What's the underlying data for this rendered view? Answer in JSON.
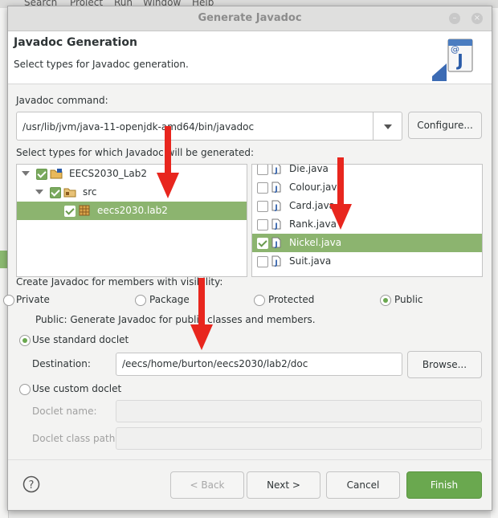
{
  "background": {
    "menu": [
      "Search",
      "Project",
      "Run",
      "Window",
      "Help"
    ]
  },
  "dialog": {
    "title": "Generate Javadoc",
    "header": {
      "title": "Javadoc Generation",
      "description": "Select types for Javadoc generation."
    },
    "command": {
      "label": "Javadoc command:",
      "value": "/usr/lib/jvm/java-11-openjdk-amd64/bin/javadoc",
      "configure_label": "Configure..."
    },
    "types_label": "Select types for which Javadoc will be generated:",
    "tree": [
      {
        "label": "EECS2030_Lab2",
        "checked": true,
        "icon": "project-icon"
      },
      {
        "label": "src",
        "checked": true,
        "icon": "source-folder-icon"
      },
      {
        "label": "eecs2030.lab2",
        "checked": true,
        "icon": "package-icon",
        "selected": true
      }
    ],
    "files": [
      {
        "label": "Die.java",
        "checked": false
      },
      {
        "label": "Colour.java",
        "checked": false
      },
      {
        "label": "Card.java",
        "checked": false
      },
      {
        "label": "Rank.java",
        "checked": false
      },
      {
        "label": "Nickel.java",
        "checked": true,
        "selected": true
      },
      {
        "label": "Suit.java",
        "checked": false
      }
    ],
    "visibility": {
      "label": "Create Javadoc for members with visibility:",
      "options": [
        "Private",
        "Package",
        "Protected",
        "Public"
      ],
      "selected": "Public",
      "description": "Public: Generate Javadoc for public classes and members."
    },
    "standard_doclet": {
      "label": "Use standard doclet",
      "destination_label": "Destination:",
      "destination_value": "/eecs/home/burton/eecs2030/lab2/doc",
      "browse_label": "Browse..."
    },
    "custom_doclet": {
      "label": "Use custom doclet",
      "name_label": "Doclet name:",
      "class_path_label": "Doclet class path:"
    },
    "buttons": {
      "back": "< Back",
      "next": "Next >",
      "cancel": "Cancel",
      "finish": "Finish"
    }
  },
  "colors": {
    "accent": "#6aa84f",
    "selection": "#8cb46f",
    "annotation_arrow": "#e8261e"
  }
}
